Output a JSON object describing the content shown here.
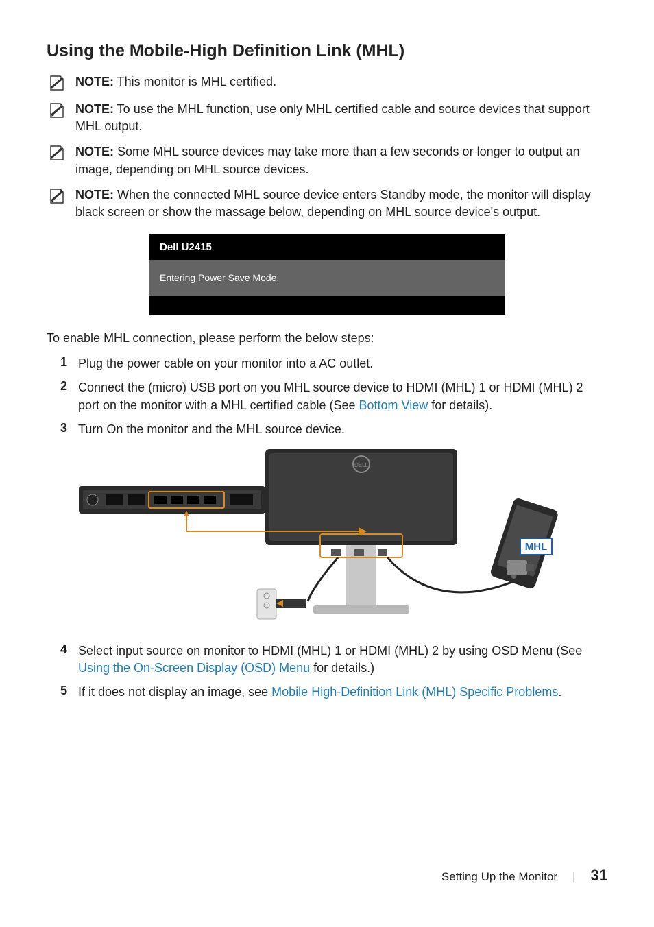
{
  "heading": "Using the Mobile-High Definition Link (MHL)",
  "notes": [
    {
      "label": "NOTE:",
      "text": " This monitor is MHL certified."
    },
    {
      "label": "NOTE:",
      "text": " To use the MHL function, use only MHL certified cable and source devices that support MHL output."
    },
    {
      "label": "NOTE:",
      "text": " Some MHL source devices may take more than a few seconds or longer to output an image, depending on MHL source devices."
    },
    {
      "label": "NOTE:",
      "text": " When the connected MHL source device enters Standby mode, the monitor will display black screen or show the massage below, depending on MHL source device's output."
    }
  ],
  "osd": {
    "title": "Dell U2415",
    "body": "Entering Power Save Mode."
  },
  "intro": "To enable MHL connection, please perform the below steps:",
  "steps": [
    {
      "num": "1",
      "parts": [
        {
          "t": "Plug the power cable on your monitor into a AC outlet."
        }
      ]
    },
    {
      "num": "2",
      "parts": [
        {
          "t": "Connect the (micro) USB port on you MHL source device to HDMI (MHL) 1 or HDMI (MHL) 2 port on the monitor with a MHL certified cable (See "
        },
        {
          "t": "Bottom View",
          "link": true
        },
        {
          "t": " for details)."
        }
      ]
    },
    {
      "num": "3",
      "parts": [
        {
          "t": "Turn On the monitor and the MHL source device."
        }
      ]
    },
    {
      "num": "4",
      "parts": [
        {
          "t": "Select input source on monitor to HDMI (MHL) 1 or HDMI (MHL) 2 by using OSD Menu (See "
        },
        {
          "t": "Using the On-Screen Display (OSD) Menu",
          "link": true
        },
        {
          "t": " for details.)"
        }
      ]
    },
    {
      "num": "5",
      "parts": [
        {
          "t": "If it does not display an image, see "
        },
        {
          "t": "Mobile High-Definition Link (MHL) Specific Problems",
          "link": true
        },
        {
          "t": "."
        }
      ]
    }
  ],
  "diagram_label": "MHL",
  "footer": {
    "section": "Setting Up the Monitor",
    "divider": "|",
    "page": "31"
  }
}
